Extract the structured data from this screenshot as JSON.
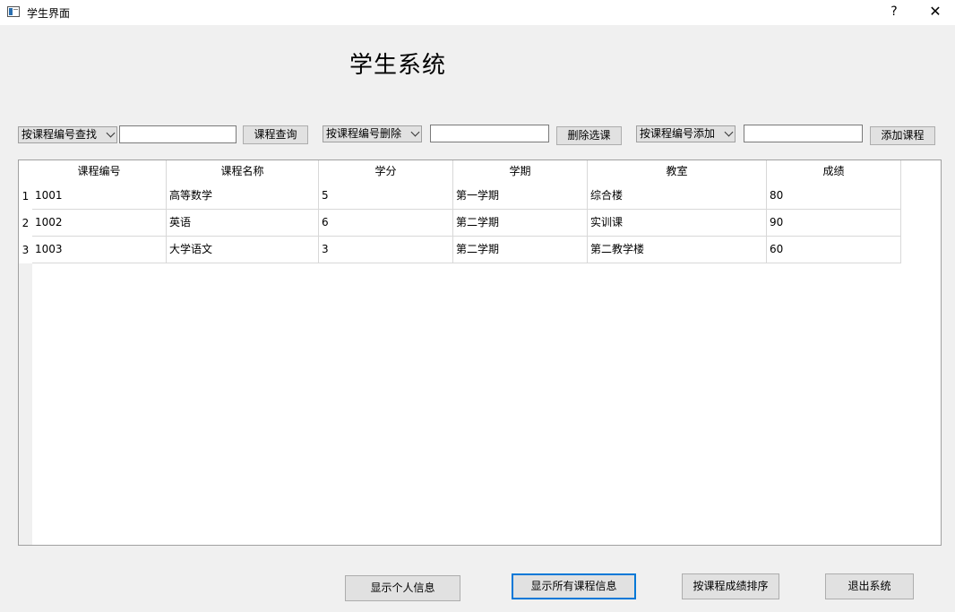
{
  "window": {
    "title": "学生界面",
    "help_label": "?",
    "close_label": "✕",
    "icon": "app-window-icon"
  },
  "page": {
    "title": "学生系统"
  },
  "toolbar": {
    "query_combo": "按课程编号查找",
    "query_input_value": "",
    "query_button": "课程查询",
    "delete_combo": "按课程编号删除",
    "delete_input_value": "",
    "delete_button": "删除选课",
    "add_combo": "按课程编号添加",
    "add_input_value": "",
    "add_button": "添加课程"
  },
  "table": {
    "columns": [
      "课程编号",
      "课程名称",
      "学分",
      "学期",
      "教室",
      "成绩"
    ],
    "row_numbers": [
      "1",
      "2",
      "3"
    ],
    "rows": [
      [
        "1001",
        "高等数学",
        "5",
        "第一学期",
        "综合楼",
        "80"
      ],
      [
        "1002",
        "英语",
        "6",
        "第二学期",
        "实训课",
        "90"
      ],
      [
        "1003",
        "大学语文",
        "3",
        "第二学期",
        "第二教学楼",
        "60"
      ]
    ]
  },
  "footer": {
    "show_personal_info": "显示个人信息",
    "show_all_courses": "显示所有课程信息",
    "sort_by_score": "按课程成绩排序",
    "exit_system": "退出系统"
  },
  "colors": {
    "background": "#f0f0f0",
    "focus_border": "#0078d7",
    "button_face": "#e1e1e1"
  }
}
